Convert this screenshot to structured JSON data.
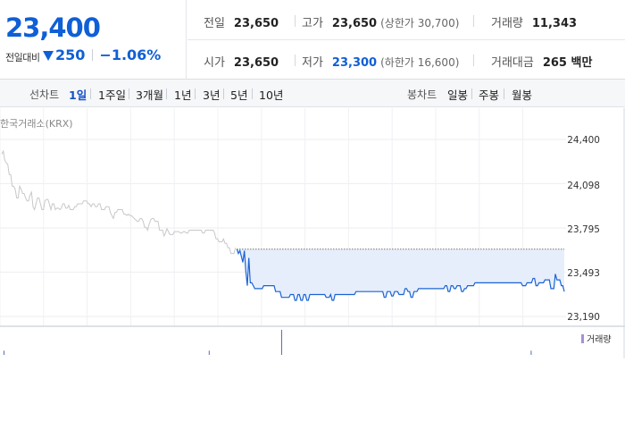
{
  "summary": {
    "price": "23,400",
    "change_label": "전일대비",
    "change_value": "250",
    "change_pct": "−1.06%",
    "prev_close": {
      "label": "전일",
      "value": "23,650"
    },
    "high": {
      "label": "고가",
      "value": "23,650",
      "sub": "(상한가 30,700)"
    },
    "volume": {
      "label": "거래량",
      "value": "11,343"
    },
    "open": {
      "label": "시가",
      "value": "23,650"
    },
    "low": {
      "label": "저가",
      "value": "23,300",
      "sub": "(하한가 16,600)"
    },
    "amount": {
      "label": "거래대금",
      "value": "265 백만"
    }
  },
  "tabs": {
    "line_title": "선차트",
    "line_items": [
      "1일",
      "1주일",
      "3개월",
      "1년",
      "3년",
      "5년",
      "10년"
    ],
    "candle_title": "봉차트",
    "candle_items": [
      "일봉",
      "주봉",
      "월봉"
    ]
  },
  "chart": {
    "market": "한국거래소(KRX)",
    "y_ticks": [
      "24,400",
      "24,098",
      "23,795",
      "23,493",
      "23,190"
    ],
    "volume_legend": "거래량"
  },
  "colors": {
    "accent": "#0f5fd6",
    "active_tab": "#1652c8",
    "prev_line": "#c8c8c8",
    "today_line": "#1a63d6",
    "today_fill": "#e6eefb"
  },
  "chart_data": {
    "type": "line",
    "y_ticks": [
      24400,
      24098,
      23795,
      23493,
      23190
    ],
    "ylim": [
      23190,
      24400
    ],
    "prev_close": 23650,
    "series": [
      {
        "values": [
          24300,
          24320,
          24260,
          24240,
          24230,
          24160,
          24160,
          24080,
          24080,
          24060,
          24000,
          24000,
          24080,
          24060,
          24030,
          24030,
          24000,
          23980,
          23980,
          24020,
          24040,
          23940,
          23920,
          23960,
          24000,
          24000,
          23960,
          23920,
          23920,
          23980,
          23990,
          23990,
          23960,
          23920,
          23960,
          23960,
          23920,
          23930,
          23930,
          23920,
          23930,
          23960,
          23960,
          23930,
          23930,
          23950,
          23920,
          23920,
          23920,
          23940,
          23940,
          23960,
          23960,
          23960,
          23960,
          23980,
          23980,
          23980,
          23960,
          23960,
          23940,
          23960,
          23960,
          23940,
          23940,
          23960,
          23960,
          23920,
          23920,
          23920,
          23940,
          23940,
          23940,
          23900,
          23880,
          23860,
          23900,
          23900,
          23920,
          23920,
          23920,
          23920,
          23890,
          23890,
          23880,
          23890,
          23880,
          23880,
          23870,
          23860,
          23850,
          23840,
          23840,
          23860,
          23860,
          23840,
          23800,
          23800,
          23780,
          23820,
          23850,
          23860,
          23860,
          23840,
          23840,
          23840,
          23780,
          23780,
          23780,
          23740,
          23760,
          23790,
          23770,
          23750,
          23750,
          23750,
          23770,
          23770,
          23770,
          23770,
          23760,
          23760,
          23770,
          23770,
          23760,
          23760,
          23780,
          23780,
          23780,
          23780,
          23780,
          23780,
          23780,
          23780,
          23780,
          23760,
          23760,
          23780,
          23780,
          23780,
          23780,
          23780,
          23780,
          23760,
          23720,
          23720,
          23700,
          23700,
          23700,
          23720,
          23690,
          23690,
          23660,
          23660,
          23620,
          23620,
          23620,
          23660
        ]
      },
      {
        "values": [
          23650,
          23620,
          23640,
          23600,
          23560,
          23640,
          23500,
          23400,
          23590,
          23420,
          23420,
          23400,
          23380,
          23380,
          23380,
          23380,
          23380,
          23380,
          23400,
          23400,
          23400,
          23400,
          23400,
          23400,
          23400,
          23400,
          23360,
          23360,
          23360,
          23360,
          23320,
          23320,
          23320,
          23320,
          23320,
          23320,
          23340,
          23340,
          23340,
          23300,
          23300,
          23340,
          23340,
          23300,
          23300,
          23340,
          23340,
          23300,
          23300,
          23340,
          23340,
          23340,
          23340,
          23340,
          23340,
          23340,
          23340,
          23340,
          23340,
          23340,
          23320,
          23320,
          23320,
          23340,
          23300,
          23300,
          23340,
          23340,
          23340,
          23340,
          23340,
          23340,
          23340,
          23340,
          23340,
          23340,
          23340,
          23340,
          23340,
          23340,
          23360,
          23360,
          23360,
          23360,
          23360,
          23360,
          23360,
          23360,
          23360,
          23360,
          23360,
          23360,
          23360,
          23360,
          23360,
          23360,
          23360,
          23360,
          23360,
          23320,
          23320,
          23360,
          23360,
          23360,
          23330,
          23330,
          23360,
          23360,
          23360,
          23340,
          23340,
          23340,
          23340,
          23380,
          23380,
          23360,
          23360,
          23320,
          23320,
          23360,
          23360,
          23360,
          23380,
          23380,
          23380,
          23380,
          23380,
          23380,
          23380,
          23380,
          23380,
          23380,
          23380,
          23380,
          23380,
          23380,
          23380,
          23380,
          23380,
          23380,
          23400,
          23400,
          23360,
          23360,
          23400,
          23400,
          23380,
          23380,
          23400,
          23400,
          23400,
          23360,
          23360,
          23380,
          23380,
          23400,
          23400,
          23400,
          23400,
          23400,
          23420,
          23420,
          23420,
          23420,
          23420,
          23420,
          23420,
          23420,
          23420,
          23420,
          23420,
          23420,
          23420,
          23420,
          23420,
          23420,
          23420,
          23420,
          23420,
          23420,
          23420,
          23420,
          23420,
          23420,
          23420,
          23420,
          23420,
          23420,
          23420,
          23420,
          23420,
          23420,
          23400,
          23400,
          23400,
          23420,
          23420,
          23420,
          23420,
          23450,
          23450,
          23400,
          23400,
          23420,
          23420,
          23420,
          23420,
          23440,
          23440,
          23440,
          23440,
          23380,
          23380,
          23380,
          23480,
          23440,
          23440,
          23440,
          23400,
          23400,
          23360
        ]
      }
    ],
    "volume": [
      0,
      1,
      0,
      0,
      0,
      0,
      0,
      0,
      0,
      0,
      0,
      0,
      0,
      0,
      0,
      0,
      0,
      0,
      0,
      0,
      0,
      0,
      0,
      0,
      0,
      0,
      0,
      0,
      0,
      0,
      0,
      0,
      0,
      0,
      0,
      0,
      0,
      0,
      0,
      0,
      0,
      0,
      0,
      0,
      0,
      0,
      0,
      0,
      0,
      0,
      0,
      0,
      0,
      0,
      0,
      0,
      0,
      0,
      0,
      0,
      0,
      0,
      0,
      0,
      0,
      0,
      0,
      0,
      0,
      0,
      0,
      0,
      0,
      0,
      0,
      0,
      0,
      0,
      0,
      0,
      0,
      0,
      0,
      0,
      0,
      0,
      0,
      0,
      0,
      0,
      0,
      0,
      0,
      0,
      0,
      0,
      0,
      0,
      0,
      0,
      0,
      0,
      0,
      0,
      0,
      0,
      0,
      0,
      0,
      0,
      0,
      0,
      0,
      0,
      0,
      0,
      0,
      1,
      0,
      0,
      0,
      0,
      0,
      0,
      0,
      0,
      0,
      0,
      0,
      0,
      0,
      0,
      0,
      0,
      0,
      0,
      0,
      0,
      0,
      0,
      0,
      0,
      0,
      0,
      0,
      0,
      0,
      0,
      0,
      0,
      0,
      0,
      0,
      0,
      0,
      0,
      0,
      0,
      6,
      0,
      0,
      0,
      0,
      0,
      0,
      0,
      0,
      0,
      0,
      0,
      0,
      0,
      0,
      0,
      0,
      0,
      0,
      0,
      0,
      0,
      0,
      0,
      0,
      0,
      0,
      0,
      0,
      0,
      0,
      0,
      0,
      0,
      0,
      0,
      0,
      0,
      0,
      0,
      0,
      0,
      0,
      0,
      0,
      0,
      0,
      0,
      0,
      0,
      0,
      0,
      0,
      0,
      0,
      0,
      0,
      0,
      0,
      0,
      0,
      0,
      0,
      0,
      0,
      0,
      0,
      0,
      0,
      0,
      0,
      0,
      0,
      0,
      0,
      0,
      0,
      0,
      0,
      0,
      0,
      0,
      0,
      0,
      0,
      0,
      0,
      0,
      0,
      0,
      0,
      0,
      0,
      0,
      0,
      0,
      0,
      0,
      0,
      0,
      0,
      0,
      0,
      0,
      0,
      0,
      0,
      0,
      0,
      0,
      0,
      0,
      0,
      0,
      0,
      0,
      0,
      0,
      0,
      0,
      0,
      0,
      0,
      0,
      0,
      0,
      0,
      0,
      0,
      0,
      0,
      0,
      0,
      0,
      0,
      0,
      0,
      0,
      0,
      0,
      0,
      1,
      0,
      0,
      0,
      0,
      0,
      0,
      0,
      0,
      0,
      0,
      0,
      0,
      0,
      0,
      0,
      0,
      0,
      0,
      0
    ]
  }
}
